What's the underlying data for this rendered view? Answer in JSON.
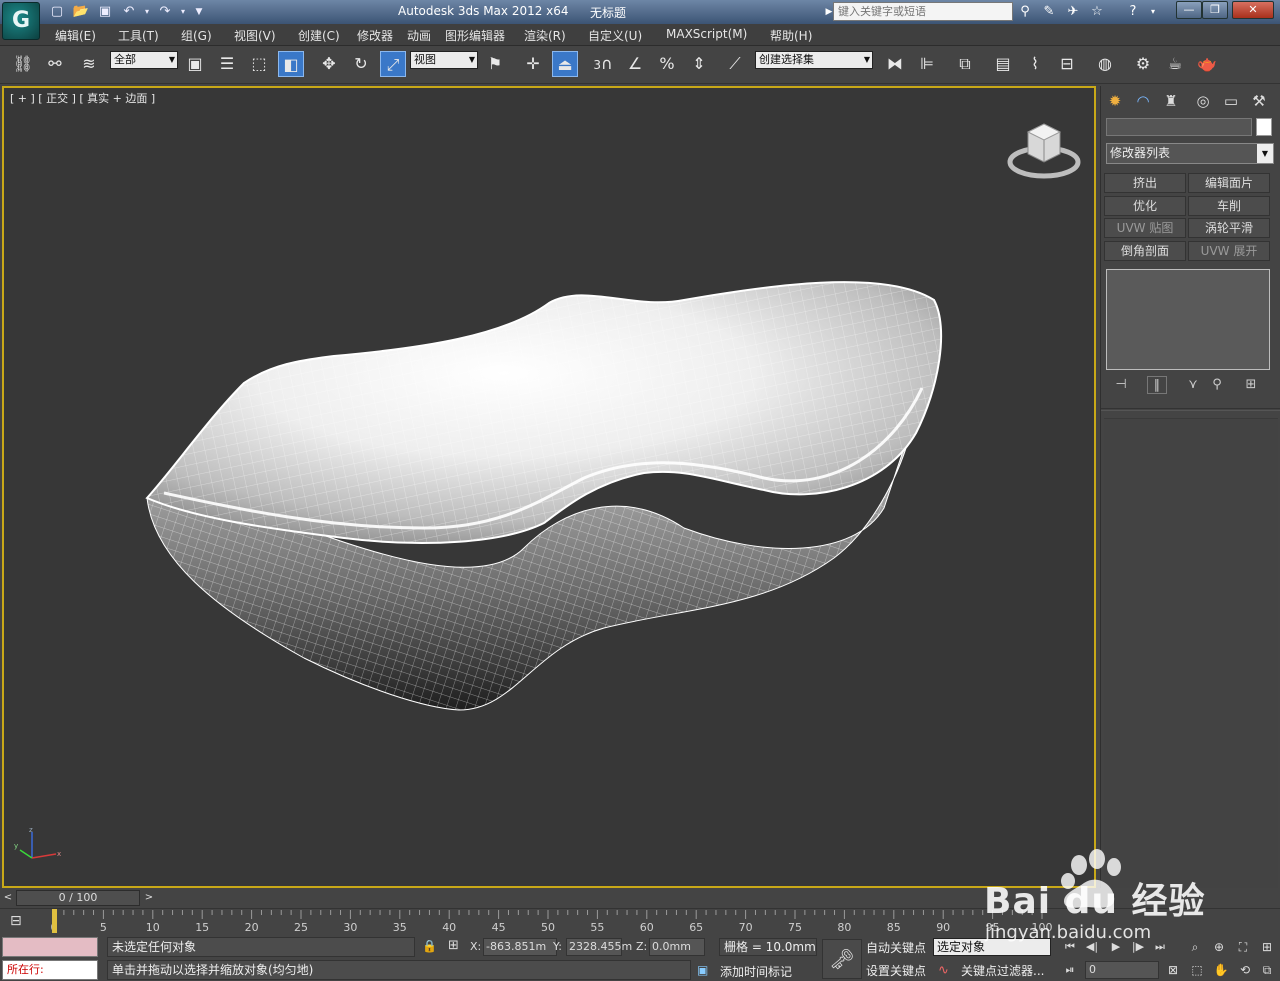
{
  "title": {
    "app": "Autodesk 3ds Max  2012 x64",
    "document": "无标题"
  },
  "quick_access": [
    "new-icon",
    "open-icon",
    "save-icon",
    "undo-icon",
    "redo-icon"
  ],
  "search": {
    "placeholder": "键入关键字或短语"
  },
  "menu": [
    "编辑(E)",
    "工具(T)",
    "组(G)",
    "视图(V)",
    "创建(C)",
    "修改器",
    "动画",
    "图形编辑器",
    "渲染(R)",
    "自定义(U)",
    "MAXScript(M)",
    "帮助(H)"
  ],
  "toolbar": {
    "selection_filter": "全部",
    "ref_coord": "视图",
    "named_selection": "创建选择集",
    "snap_label": "3"
  },
  "viewport": {
    "label": "[ + ] [ 正交 ] [ 真实 + 边面 ]"
  },
  "command_panel": {
    "modifier_list": "修改器列表",
    "modifier_buttons": [
      {
        "label": "挤出",
        "enabled": true
      },
      {
        "label": "编辑面片",
        "enabled": true
      },
      {
        "label": "优化",
        "enabled": true
      },
      {
        "label": "车削",
        "enabled": true
      },
      {
        "label": "UVW 贴图",
        "enabled": false
      },
      {
        "label": "涡轮平滑",
        "enabled": true
      },
      {
        "label": "倒角剖面",
        "enabled": true
      },
      {
        "label": "UVW 展开",
        "enabled": false
      }
    ]
  },
  "timeline": {
    "frame_display": "0 / 100",
    "ticks": [
      0,
      5,
      10,
      15,
      20,
      25,
      30,
      35,
      40,
      45,
      50,
      55,
      60,
      65,
      70,
      75,
      80,
      85,
      90,
      95,
      100
    ]
  },
  "status": {
    "maxscript_label": "所在行:",
    "line1": "未选定任何对象",
    "line2": "单击并拖动以选择并缩放对象(均匀地)",
    "x_label": "X:",
    "x_value": "-863.851m",
    "y_label": "Y:",
    "y_value": "2328.455m",
    "z_label": "Z:",
    "z_value": "0.0mm",
    "grid": "栅格 = 10.0mm",
    "add_time_tag": "添加时间标记",
    "auto_key": "自动关键点",
    "set_key": "设置关键点",
    "key_target": "选定对象",
    "key_filters": "关键点过滤器...",
    "frame": "0"
  },
  "watermark": {
    "brand": "Bai du 经验",
    "url": "jingyan.baidu.com"
  },
  "colors": {
    "viewport_bg": "#373737",
    "active_border": "#c8a818",
    "title_gradient_top": "#6d86a6"
  }
}
